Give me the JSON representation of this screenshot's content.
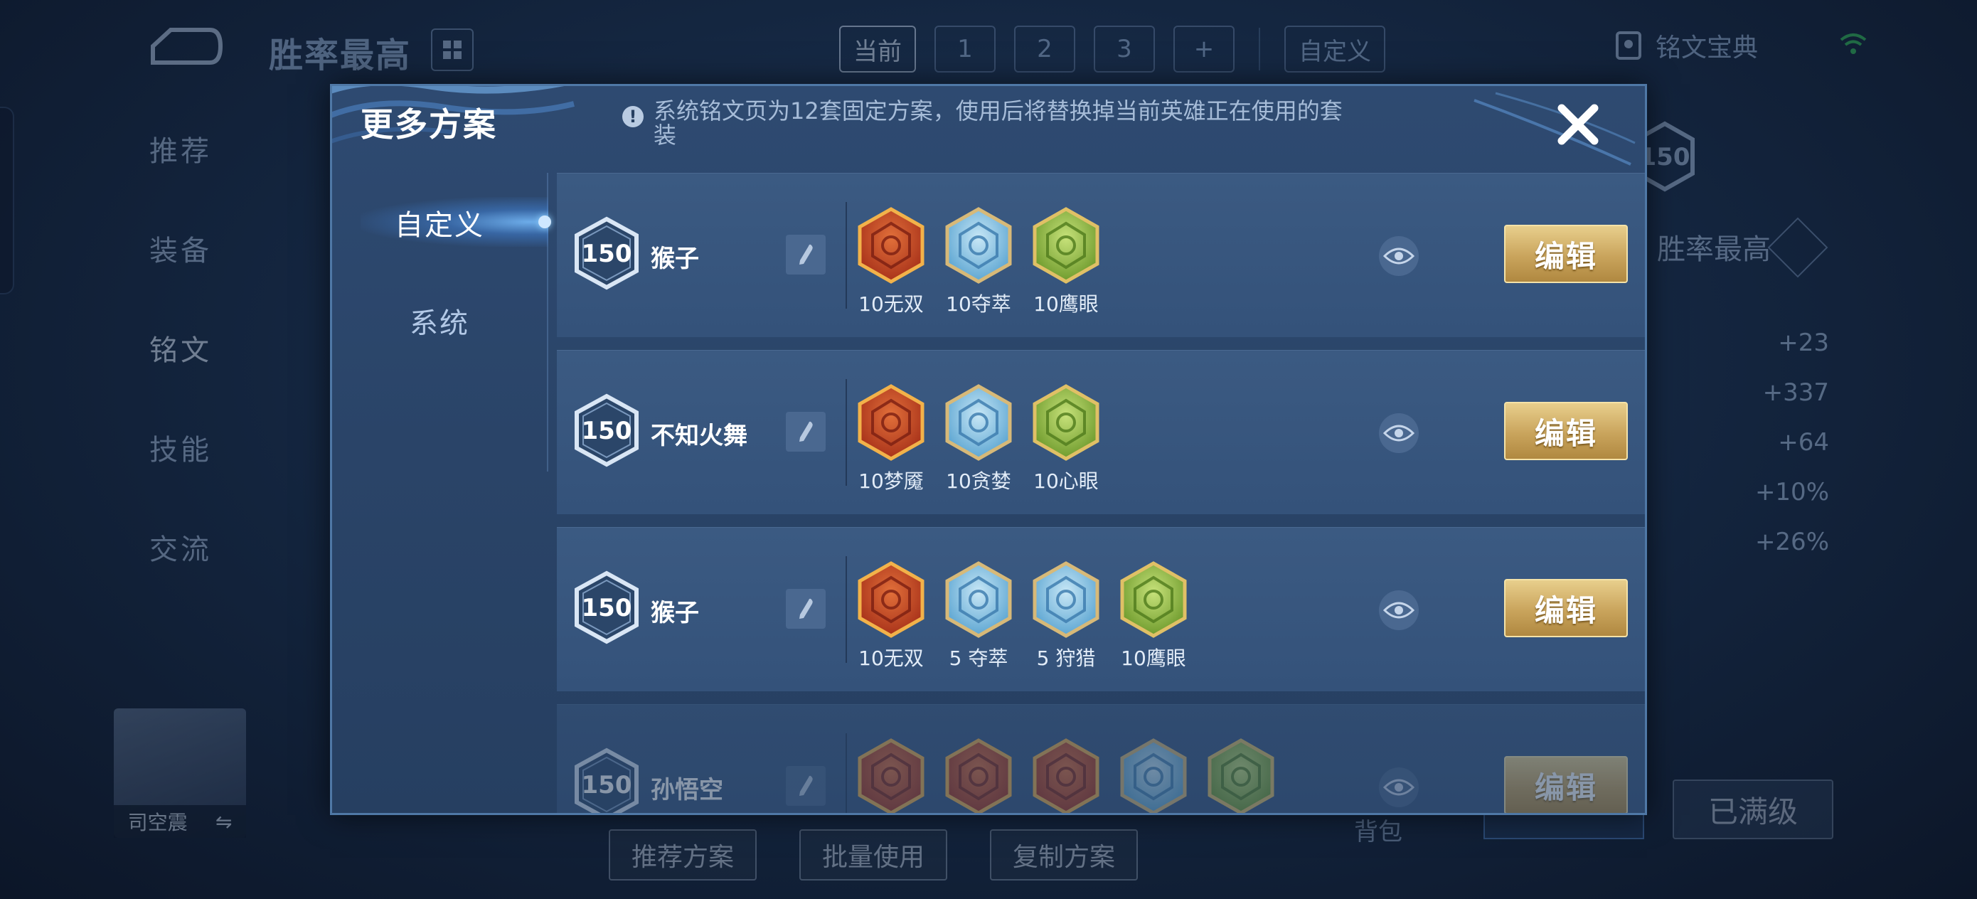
{
  "background": {
    "title": "胜率最高",
    "page_tabs": [
      "当前",
      "1",
      "2",
      "3",
      "+"
    ],
    "custom_tab": "自定义",
    "rune_book": "铭文宝典",
    "side_nav": [
      "推荐",
      "装备",
      "铭文",
      "技能",
      "交流"
    ],
    "stats": [
      "+23",
      "+337",
      "+64",
      "+10%",
      "+26%"
    ],
    "right_badge_level": "150",
    "right_title": "胜率最高",
    "hero_name": "司空震",
    "swap_symbol": "⇋",
    "bottom_buttons": [
      "推荐方案",
      "批量使用",
      "复制方案"
    ],
    "bag_label": "背包",
    "full_level_label": "已满级"
  },
  "modal": {
    "title": "更多方案",
    "notice": "系统铭文页为12套固定方案，使用后将替换掉当前英雄正在使用的套装",
    "nav": {
      "custom": "自定义",
      "system": "系统"
    },
    "rows": [
      {
        "level": "150",
        "hero": "猴子",
        "edit_label": "编辑",
        "runes": [
          {
            "label": "10无双",
            "color": "red"
          },
          {
            "label": "10夺萃",
            "color": "blue"
          },
          {
            "label": "10鹰眼",
            "color": "green"
          }
        ]
      },
      {
        "level": "150",
        "hero": "不知火舞",
        "edit_label": "编辑",
        "runes": [
          {
            "label": "10梦魇",
            "color": "red"
          },
          {
            "label": "10贪婪",
            "color": "blue"
          },
          {
            "label": "10心眼",
            "color": "green"
          }
        ]
      },
      {
        "level": "150",
        "hero": "猴子",
        "edit_label": "编辑",
        "runes": [
          {
            "label": "10无双",
            "color": "red"
          },
          {
            "label": "5 夺萃",
            "color": "blue"
          },
          {
            "label": "5 狩猎",
            "color": "blue"
          },
          {
            "label": "10鹰眼",
            "color": "green"
          }
        ]
      },
      {
        "level": "150",
        "hero": "孙悟空",
        "edit_label": "编辑",
        "runes": [
          {
            "label": "",
            "color": "red"
          },
          {
            "label": "",
            "color": "red"
          },
          {
            "label": "",
            "color": "red"
          },
          {
            "label": "",
            "color": "blue"
          },
          {
            "label": "",
            "color": "green"
          }
        ]
      }
    ]
  },
  "colors": {
    "accent_gold": "#c9a45c",
    "modal_bg": "#2a4468",
    "rune_red": "#c9401c",
    "rune_blue": "#7fc3e8",
    "rune_green": "#8bc34a"
  }
}
